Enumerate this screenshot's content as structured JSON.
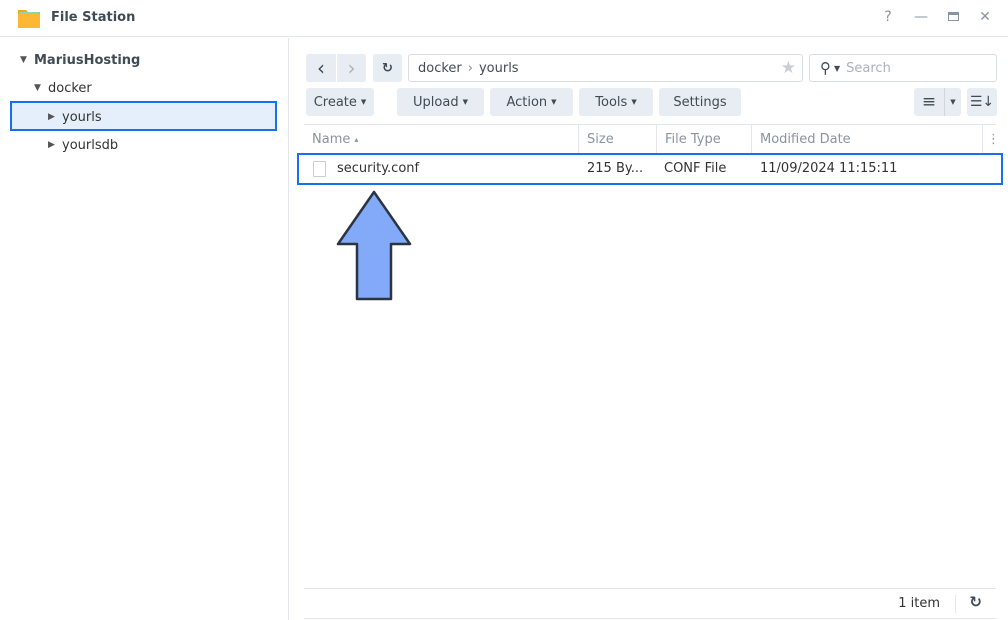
{
  "window": {
    "title": "File Station",
    "help": "?",
    "minimize": "—",
    "close": "✕"
  },
  "sidebar": {
    "root": "MariusHosting",
    "items": [
      {
        "label": "docker"
      },
      {
        "label": "yourls"
      },
      {
        "label": "yourlsdb"
      }
    ]
  },
  "toolbar": {
    "back": "‹",
    "forward": "›",
    "refresh": "↻",
    "path": [
      "docker",
      "yourls"
    ],
    "path_sep": "›",
    "search_placeholder": "Search",
    "buttons": [
      "Create",
      "Upload",
      "Action",
      "Tools",
      "Settings"
    ]
  },
  "table": {
    "columns": [
      "Name",
      "Size",
      "File Type",
      "Modified Date"
    ],
    "sort_indicator": "▴",
    "rows": [
      {
        "name": "security.conf",
        "size": "215 By...",
        "type": "CONF File",
        "modified": "11/09/2024 11:15:11"
      }
    ]
  },
  "footer": {
    "count": "1 item"
  },
  "colors": {
    "accent": "#1a6ff0",
    "arrow_fill": "#82aaf9",
    "arrow_stroke": "#2b3440"
  }
}
